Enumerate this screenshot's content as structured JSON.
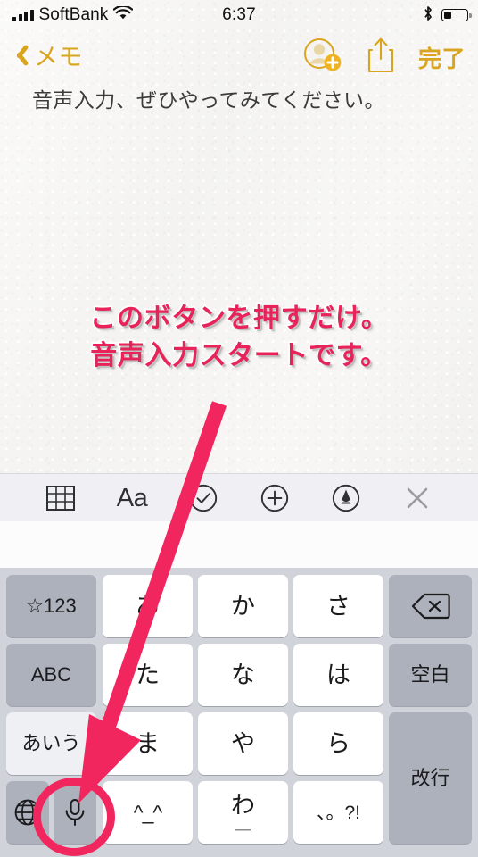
{
  "status_bar": {
    "carrier": "SoftBank",
    "time": "6:37",
    "signal_icon": "signal-bars-icon",
    "wifi_icon": "wifi-icon",
    "bluetooth_icon": "bluetooth-icon",
    "battery_icon": "battery-icon"
  },
  "nav_bar": {
    "back_label": "メモ",
    "back_icon": "chevron-left-icon",
    "add_person_icon": "add-person-icon",
    "share_icon": "share-icon",
    "done_label": "完了",
    "accent_color": "#d9a520"
  },
  "note": {
    "lines": [
      "音声入力、ぜひやってみてください。"
    ],
    "text_color": "#3b3b3c",
    "background_color": "#f6f5f3"
  },
  "annotation": {
    "line1": "このボタンを押すだけ。",
    "line2": "音声入力スタートです。",
    "text_color": "#e8235a",
    "outline_color": "#ffffff",
    "arrow_color": "#f2265e",
    "highlight_color": "#f2265e",
    "highlight_target": "microphone-key"
  },
  "toolbar": {
    "background_color": "#f0eff3",
    "items": [
      {
        "name": "table-icon",
        "label": ""
      },
      {
        "name": "text-format-icon",
        "label": "Aa"
      },
      {
        "name": "checklist-icon",
        "label": ""
      },
      {
        "name": "add-attachment-icon",
        "label": ""
      },
      {
        "name": "markup-pen-icon",
        "label": ""
      },
      {
        "name": "close-keyboard-icon",
        "label": ""
      }
    ]
  },
  "keyboard": {
    "type": "japanese-kana-10key",
    "background_color": "#d0d3d9",
    "keys": {
      "numbers": "☆123",
      "abc": "ABC",
      "kana": "あいう",
      "globe": "globe-icon",
      "mic": "microphone-icon",
      "a": "あ",
      "ka": "か",
      "sa": "さ",
      "ta": "た",
      "na": "な",
      "ha": "は",
      "ma": "ま",
      "ya": "や",
      "ra": "ら",
      "kaomoji": "^_^",
      "wa": "わ",
      "wa_under": "＿",
      "punct": "、。?!",
      "delete": "delete-icon",
      "space": "空白",
      "return": "改行"
    }
  }
}
